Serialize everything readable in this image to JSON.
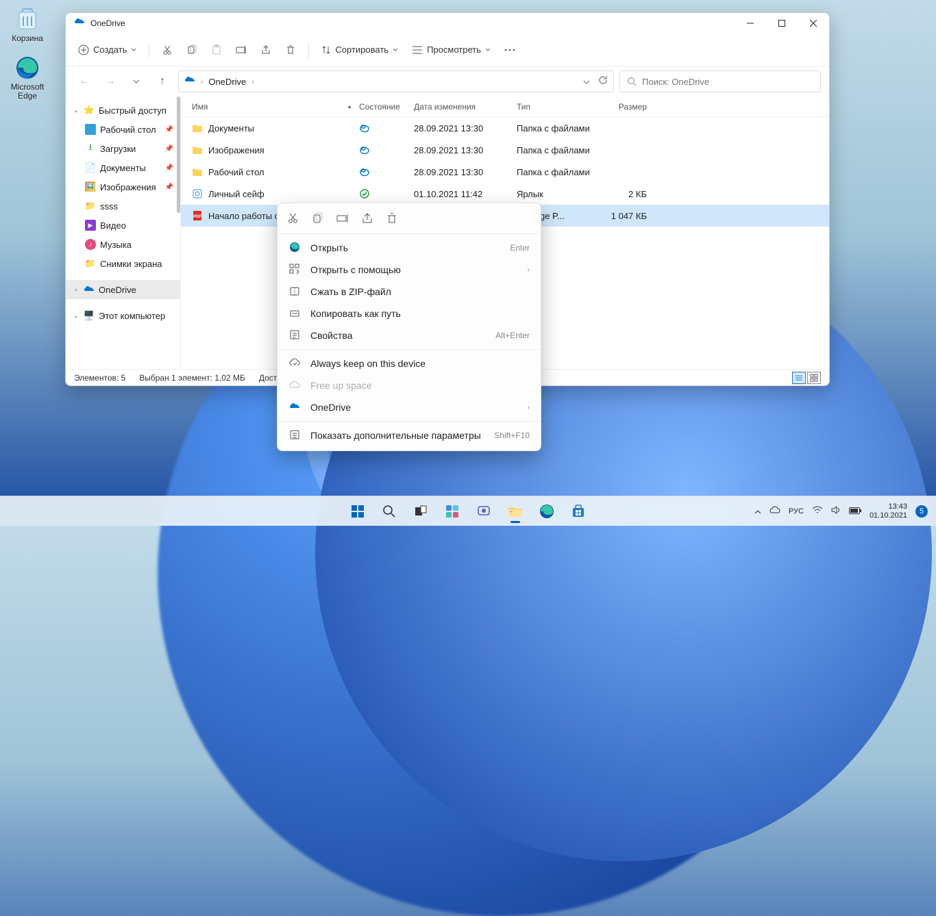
{
  "desktop": {
    "recycle": "Корзина",
    "edge1": "Microsoft",
    "edge2": "Edge"
  },
  "window": {
    "title": "OneDrive",
    "toolbar": {
      "new": "Создать",
      "sort": "Сортировать",
      "view": "Просмотреть"
    },
    "breadcrumb": "OneDrive",
    "search_placeholder": "Поиск: OneDrive",
    "columns": {
      "name": "Имя",
      "state": "Состояние",
      "date": "Дата изменения",
      "type": "Тип",
      "size": "Размер"
    },
    "sidebar": {
      "quick": "Быстрый доступ",
      "desktop": "Рабочий стол",
      "downloads": "Загрузки",
      "documents": "Документы",
      "pictures": "Изображения",
      "ssss": "ssss",
      "video": "Видео",
      "music": "Музыка",
      "screens": "Снимки экрана",
      "onedrive": "OneDrive",
      "thispc": "Этот компьютер"
    },
    "rows": [
      {
        "name": "Документы",
        "date": "28.09.2021 13:30",
        "type": "Папка с файлами",
        "size": "",
        "kind": "folder"
      },
      {
        "name": "Изображения",
        "date": "28.09.2021 13:30",
        "type": "Папка с файлами",
        "size": "",
        "kind": "folder"
      },
      {
        "name": "Рабочий стол",
        "date": "28.09.2021 13:30",
        "type": "Папка с файлами",
        "size": "",
        "kind": "folder"
      },
      {
        "name": "Личный сейф",
        "date": "01.10.2021 11:42",
        "type": "Ярлык",
        "size": "2 КБ",
        "kind": "vault"
      },
      {
        "name": "Начало работы с O",
        "date": "",
        "type": "oft Edge P...",
        "size": "1 047 КБ",
        "kind": "pdf"
      }
    ],
    "status": {
      "elements": "Элементов: 5",
      "selected": "Выбран 1 элемент: 1,02 МБ",
      "avail": "Досту"
    }
  },
  "context": {
    "open": "Открыть",
    "open_hint": "Enter",
    "openwith": "Открыть с помощью",
    "zip": "Сжать в ZIP-файл",
    "copypath": "Копировать как путь",
    "props": "Свойства",
    "props_hint": "Alt+Enter",
    "keep": "Always keep on this device",
    "free": "Free up space",
    "onedrive": "OneDrive",
    "more": "Показать дополнительные параметры",
    "more_hint": "Shift+F10"
  },
  "tray": {
    "lang": "РУС",
    "time": "13:43",
    "date": "01.10.2021",
    "badge": "5"
  }
}
